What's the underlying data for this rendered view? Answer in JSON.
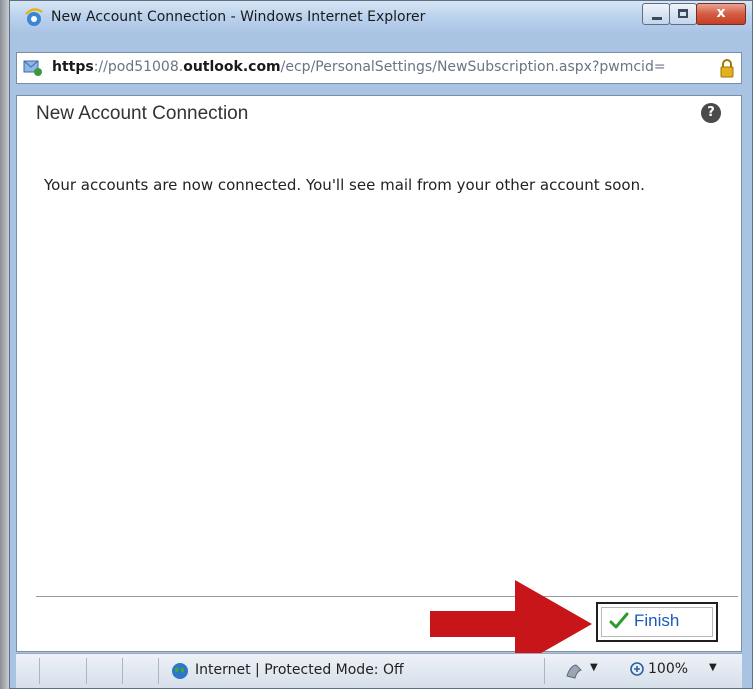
{
  "window": {
    "title": "New Account Connection - Windows Internet Explorer",
    "close_glyph": "x"
  },
  "address": {
    "url_scheme": "https",
    "url_pre": "://pod51008.",
    "url_domain": "outlook.com",
    "url_rest": "/ecp/PersonalSettings/NewSubscription.aspx?pwmcid="
  },
  "dialog": {
    "title": "New Account Connection",
    "help_glyph": "?",
    "message": "Your accounts are now connected. You'll see mail from your other account soon.",
    "finish_label": "Finish"
  },
  "status": {
    "zone_text": "Internet | Protected Mode: Off",
    "zoom": "100%"
  },
  "colors": {
    "arrow": "#c8151a",
    "finish_text": "#1a5bb8",
    "check": "#2e9b2e"
  },
  "icons": [
    "ie-icon",
    "page-icon",
    "lock-icon",
    "help-icon",
    "check-icon",
    "globe-icon",
    "security-icon",
    "zoom-icon"
  ]
}
